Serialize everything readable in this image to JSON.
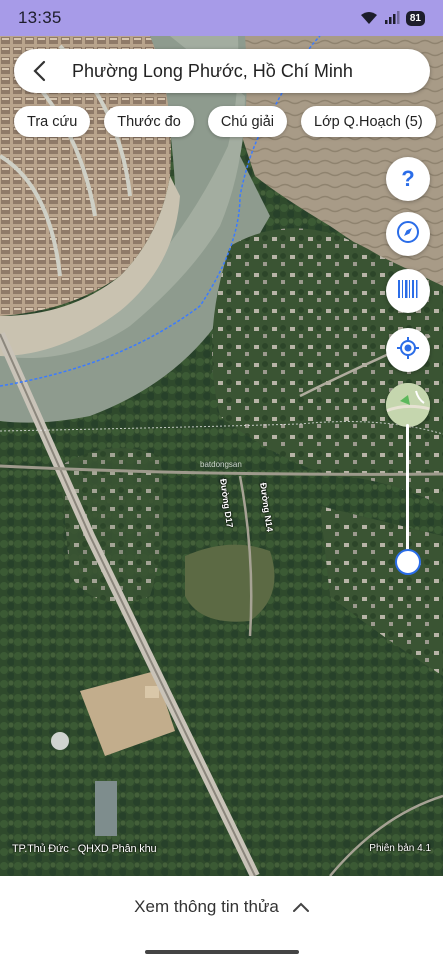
{
  "status": {
    "time": "13:35",
    "battery": "81"
  },
  "search": {
    "text": "Phường Long Phước, Hồ Chí Minh"
  },
  "chips": [
    "Tra cứu",
    "Thước đo",
    "Chú giải",
    "Lớp Q.Hoạch (5)"
  ],
  "fabs": {
    "help": "?"
  },
  "map": {
    "layer_label": "TP.Thủ Đức - QHXD Phân khu",
    "version_label": "Phiên bản 4.1",
    "road_label_1": "Đường D17",
    "road_label_2": "Đường N14",
    "watermark": "batdongsan"
  },
  "slider": {
    "level": 0.9
  },
  "bottom": {
    "label": "Xem thông tin thửa"
  },
  "colors": {
    "accent": "#2b6de8",
    "status_bar": "#a79be8"
  }
}
